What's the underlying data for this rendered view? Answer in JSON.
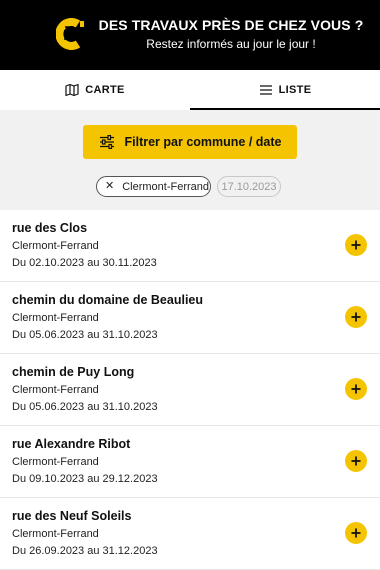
{
  "header": {
    "logo_icon": "brand-c-logo",
    "title": "DES TRAVAUX PRÈS DE CHEZ VOUS ?",
    "subtitle": "Restez informés au jour le jour !",
    "background": "#000000"
  },
  "tabs": [
    {
      "label": "CARTE",
      "icon": "map-icon",
      "active": false
    },
    {
      "label": "LISTE",
      "icon": "list-icon",
      "active": true
    }
  ],
  "filter": {
    "button_label": "Filtrer par commune / date",
    "button_icon": "sliders-icon",
    "accent": "#f5c400",
    "chips": {
      "city": "Clermont-Ferrand",
      "date": "17.10.2023"
    }
  },
  "works": [
    {
      "street": "rue des Clos",
      "city": "Clermont-Ferrand",
      "dates": "Du 02.10.2023 au 30.11.2023"
    },
    {
      "street": "chemin du domaine de Beaulieu",
      "city": "Clermont-Ferrand",
      "dates": "Du 05.06.2023 au 31.10.2023"
    },
    {
      "street": "chemin de Puy Long",
      "city": "Clermont-Ferrand",
      "dates": "Du 05.06.2023 au 31.10.2023"
    },
    {
      "street": "rue Alexandre Ribot",
      "city": "Clermont-Ferrand",
      "dates": "Du 09.10.2023 au 29.12.2023"
    },
    {
      "street": "rue des Neuf Soleils",
      "city": "Clermont-Ferrand",
      "dates": "Du 26.09.2023 au 31.12.2023"
    }
  ]
}
